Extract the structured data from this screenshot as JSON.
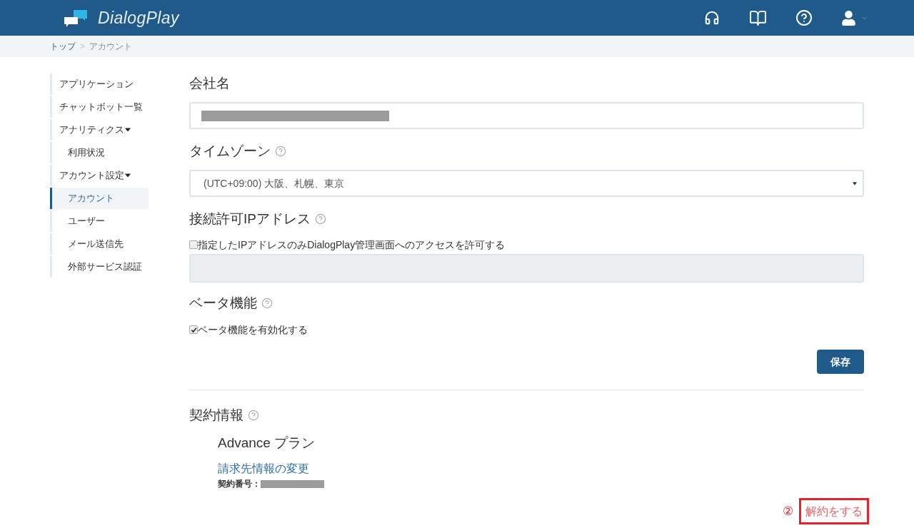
{
  "header": {
    "brand": "DialogPlay",
    "account_menu_expandable": true
  },
  "breadcrumb": {
    "items": [
      "トップ",
      "アカウント"
    ],
    "separator": ">"
  },
  "sidebar": {
    "items": [
      {
        "label": "アプリケーション",
        "selected": false
      },
      {
        "label": "チャットボット一覧",
        "selected": false
      },
      {
        "label": "アナリティクス",
        "selected": false,
        "expanded": true,
        "children": [
          {
            "label": "利用状況",
            "selected": false
          }
        ]
      },
      {
        "label": "アカウント設定",
        "selected": false,
        "expanded": true,
        "children": [
          {
            "label": "アカウント",
            "selected": true
          },
          {
            "label": "ユーザー",
            "selected": false
          },
          {
            "label": "メール送信先",
            "selected": false
          },
          {
            "label": "外部サービス認証",
            "selected": false
          }
        ]
      }
    ]
  },
  "form": {
    "company_name": {
      "label": "会社名",
      "redacted": true
    },
    "timezone": {
      "label": "タイムゾーン",
      "help": true,
      "value": "(UTC+09:00) 大阪、札幌、東京"
    },
    "allowed_ip": {
      "label": "接続許可IPアドレス",
      "help": true,
      "checkbox": {
        "label": "指定したIPアドレスのみDialogPlay管理画面へのアクセスを許可する",
        "checked": false
      },
      "textarea": {
        "disabled": true
      }
    },
    "beta": {
      "label": "ベータ機能",
      "help": true,
      "checkbox": {
        "label": "ベータ機能を有効化する",
        "checked": true
      }
    },
    "save_button": "保存"
  },
  "contract": {
    "label": "契約情報",
    "help": true,
    "plan": "Advance プラン",
    "billing_link": "請求先情報の変更",
    "number_label": "契約番号：",
    "number_redacted": true,
    "annotation_marker": "②",
    "cancel_link": "解約をする",
    "cancel_highlighted": true
  }
}
